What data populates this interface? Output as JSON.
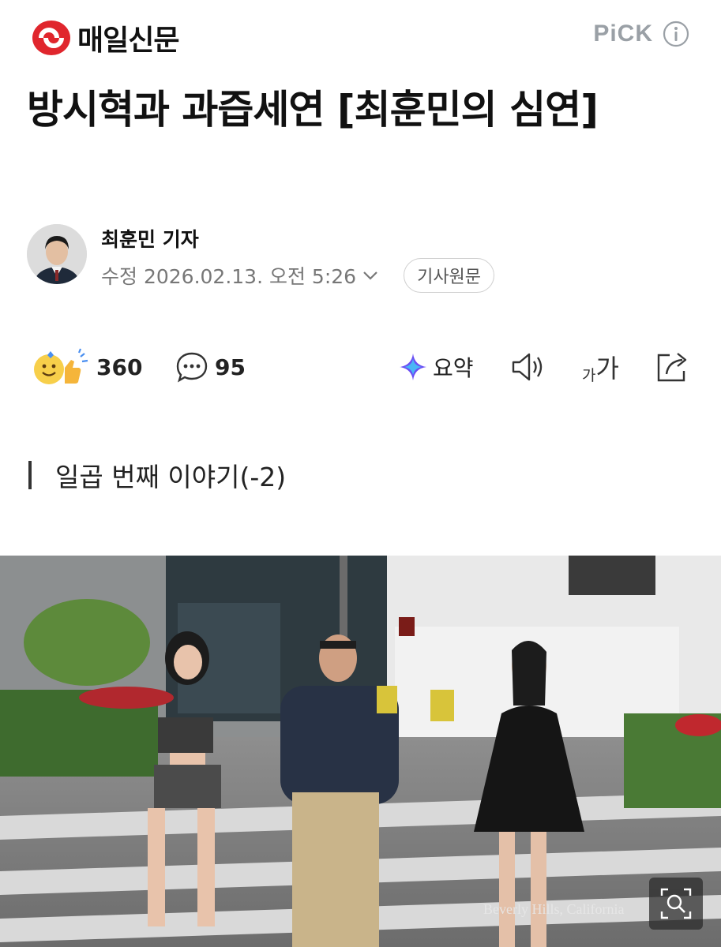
{
  "header": {
    "logo_text": "매일신문",
    "pick_label": "PiCK",
    "brand_color": "#e0262d"
  },
  "article": {
    "title": "방시혁과 과즙세연 [최훈민의 심연]",
    "reporter": "최훈민 기자",
    "date": "수정 2026.02.13. 오전 5:26",
    "original_button": "기사원문",
    "subheading": "일곱 번째 이야기(-2)"
  },
  "actions": {
    "reaction_count": "360",
    "comment_count": "95",
    "summary_label": "요약",
    "font_small": "가",
    "font_large": "가"
  },
  "photo": {
    "watermark": "Beverly Hills, California"
  },
  "icons": [
    "logo-mark-icon",
    "info-icon",
    "chevron-down-icon",
    "reaction-icon",
    "comment-icon",
    "sparkle-icon",
    "speaker-icon",
    "share-icon",
    "zoom-icon"
  ]
}
